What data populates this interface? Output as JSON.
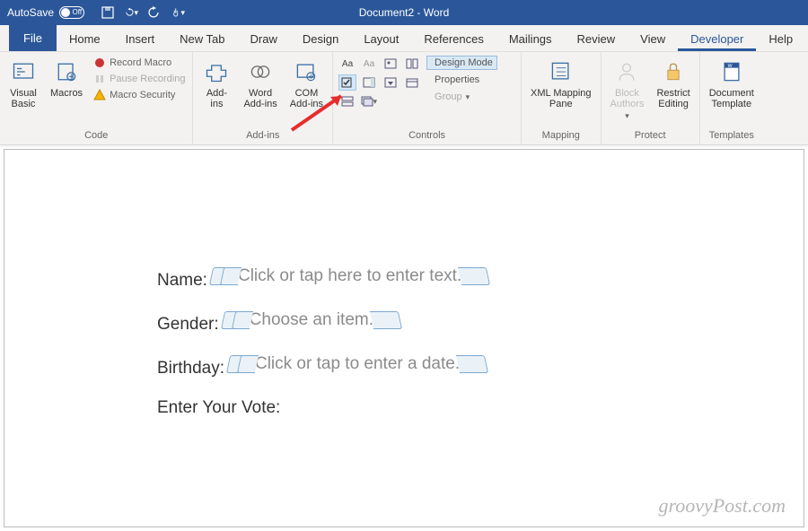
{
  "titlebar": {
    "autosave_label": "AutoSave",
    "toggle_state": "Off",
    "document_title": "Document2  -  Word"
  },
  "tabs": {
    "file": "File",
    "items": [
      "Home",
      "Insert",
      "New Tab",
      "Draw",
      "Design",
      "Layout",
      "References",
      "Mailings",
      "Review",
      "View",
      "Developer",
      "Help"
    ],
    "active": "Developer"
  },
  "ribbon": {
    "code": {
      "visual_basic": "Visual\nBasic",
      "macros": "Macros",
      "record_macro": "Record Macro",
      "pause_recording": "Pause Recording",
      "macro_security": "Macro Security",
      "label": "Code"
    },
    "addins": {
      "addins": "Add-\nins",
      "word_addins": "Word\nAdd-ins",
      "com_addins": "COM\nAdd-ins",
      "label": "Add-ins"
    },
    "controls": {
      "design_mode": "Design Mode",
      "properties": "Properties",
      "group": "Group",
      "label": "Controls"
    },
    "mapping": {
      "xml_mapping": "XML Mapping\nPane",
      "label": "Mapping"
    },
    "protect": {
      "block_authors": "Block\nAuthors",
      "restrict_editing": "Restrict\nEditing",
      "label": "Protect"
    },
    "templates": {
      "doc_template": "Document\nTemplate",
      "label": "Templates"
    }
  },
  "form": {
    "name_label": "Name:",
    "name_placeholder": "Click or tap here to enter text.",
    "gender_label": "Gender:",
    "gender_placeholder": "Choose an item.",
    "birthday_label": "Birthday:",
    "birthday_placeholder": "Click or tap to enter a date.",
    "vote_label": "Enter Your Vote:"
  },
  "watermark": "groovyPost.com"
}
